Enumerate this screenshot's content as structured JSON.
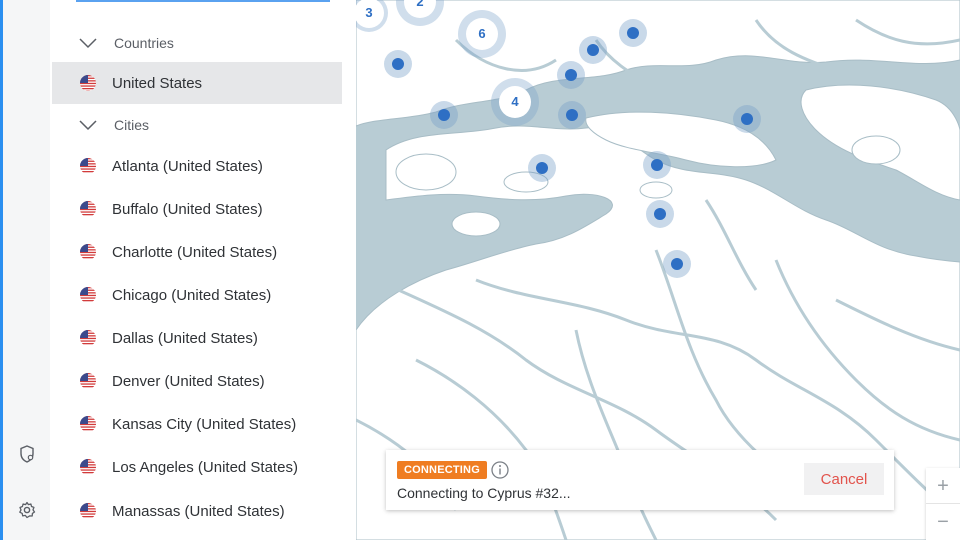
{
  "sidebar": {
    "sections": {
      "countries": "Countries",
      "cities": "Cities"
    },
    "countries": [
      {
        "label": "United States",
        "selected": true
      }
    ],
    "cities": [
      "Atlanta (United States)",
      "Buffalo (United States)",
      "Charlotte (United States)",
      "Chicago (United States)",
      "Dallas (United States)",
      "Denver (United States)",
      "Kansas City (United States)",
      "Los Angeles (United States)",
      "Manassas (United States)"
    ]
  },
  "map": {
    "clusters": [
      "3",
      "2",
      "6",
      "4"
    ],
    "zoom_in": "+",
    "zoom_out": "−"
  },
  "status": {
    "badge": "CONNECTING",
    "message": "Connecting to Cyprus #32...",
    "cancel_label": "Cancel"
  },
  "colors": {
    "accent": "#2b8ff0",
    "badge": "#ef7d22",
    "cancel_text": "#e2534c",
    "map_water": "#b8ccd4",
    "map_land": "#ffffff",
    "pin": "#2e6fc4"
  },
  "icons": {
    "rail": [
      "shield-icon",
      "gear-icon"
    ],
    "flag": "us-flag-icon",
    "info": "info-icon",
    "chevron": "chevron-down-icon"
  }
}
